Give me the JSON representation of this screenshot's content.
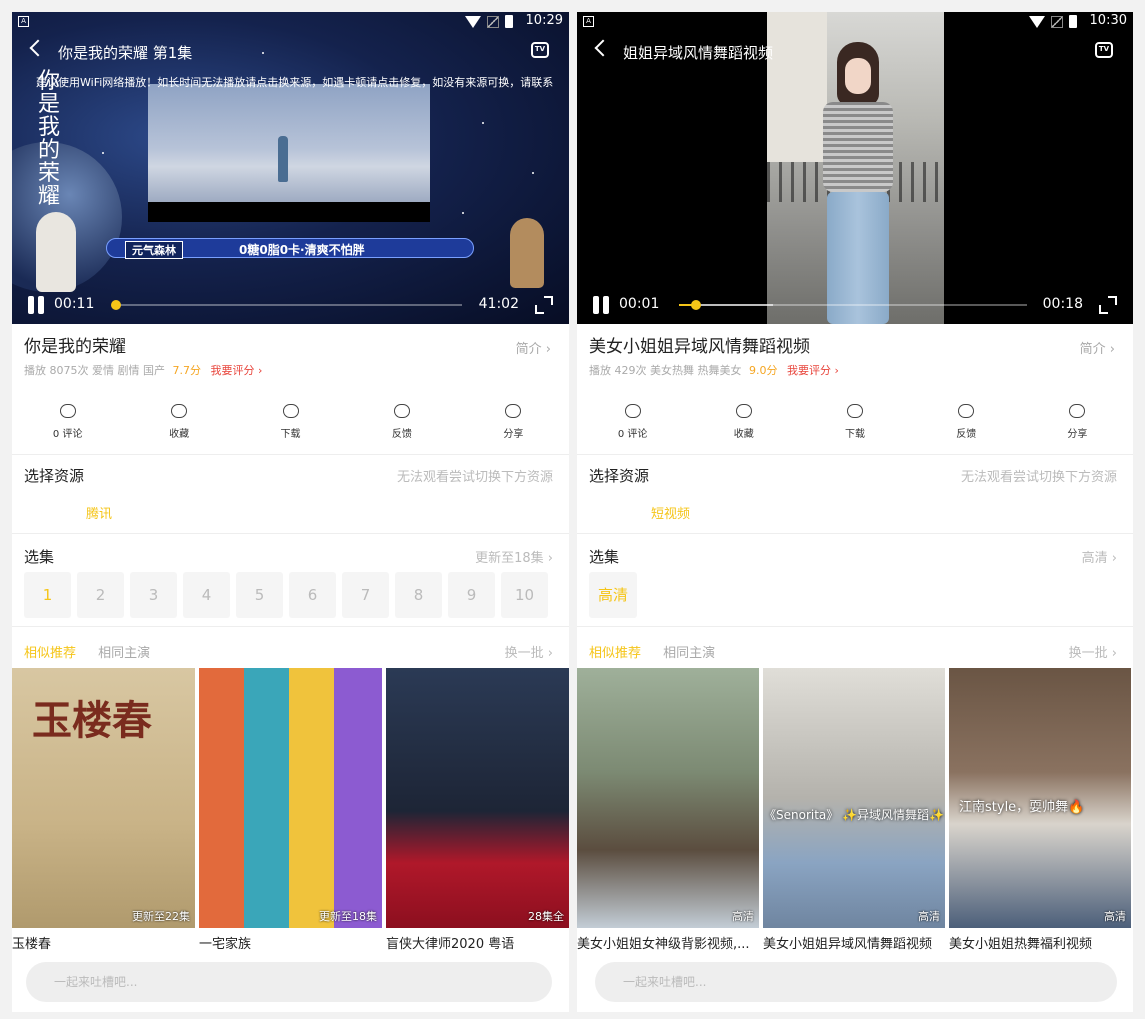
{
  "screens": [
    {
      "status": {
        "time": "10:29",
        "sim": "A"
      },
      "title": "你是我的荣耀 第1集",
      "notice": "建议使用WiFi网络播放！如长时间无法播放请点击换来源，如遇卡顿请点击修复，如没有来源可换，请联系",
      "poster_text": "你是我的荣耀",
      "ad_tag": "元气森林",
      "ad_slogan": "0糖0脂0卡·清爽不怕胖",
      "player": {
        "current": "00:11",
        "duration": "41:02",
        "progress": 0.01,
        "buffered": 0.0
      },
      "video_title": "你是我的荣耀",
      "intro": "简介 ›",
      "meta": {
        "plays": "播放 8075次",
        "tags": "爱情 剧情 国产",
        "score": "7.7分",
        "rate": "我要评分 ›"
      },
      "actions": [
        {
          "label": "0 评论",
          "icon": "comment-icon"
        },
        {
          "label": "收藏",
          "icon": "heart-icon"
        },
        {
          "label": "下载",
          "icon": "download-icon"
        },
        {
          "label": "反馈",
          "icon": "feedback-icon"
        },
        {
          "label": "分享",
          "icon": "share-icon"
        }
      ],
      "source_title": "选择资源",
      "source_hint": "无法观看尝试切换下方资源",
      "source": "腾讯",
      "episodes_title": "选集",
      "episodes_note": "更新至18集 ›",
      "episodes": [
        "1",
        "2",
        "3",
        "4",
        "5",
        "6",
        "7",
        "8",
        "9",
        "10"
      ],
      "tab_similar": "相似推荐",
      "tab_cast": "相同主演",
      "refresh": "换一批 ›",
      "recs": [
        {
          "name": "玉楼春",
          "badge": "更新至22集"
        },
        {
          "name": "一宅家族",
          "badge": "更新至18集"
        },
        {
          "name": "盲侠大律师2020 粤语",
          "badge": "28集全"
        }
      ],
      "comment_placeholder": "一起来吐槽吧..."
    },
    {
      "status": {
        "time": "10:30",
        "sim": "A"
      },
      "title": "姐姐异域风情舞蹈视频",
      "player": {
        "current": "00:01",
        "duration": "00:18",
        "progress": 0.05,
        "buffered": 0.27
      },
      "video_title": "美女小姐姐异域风情舞蹈视频",
      "intro": "简介 ›",
      "meta": {
        "plays": "播放 429次",
        "tags": "美女热舞 热舞美女",
        "score": "9.0分",
        "rate": "我要评分 ›"
      },
      "actions": [
        {
          "label": "0 评论",
          "icon": "comment-icon"
        },
        {
          "label": "收藏",
          "icon": "heart-icon"
        },
        {
          "label": "下载",
          "icon": "download-icon"
        },
        {
          "label": "反馈",
          "icon": "feedback-icon"
        },
        {
          "label": "分享",
          "icon": "share-icon"
        }
      ],
      "source_title": "选择资源",
      "source_hint": "无法观看尝试切换下方资源",
      "source": "短视频",
      "episodes_title": "选集",
      "episodes_note": "高清 ›",
      "episodes": [
        "高清"
      ],
      "tab_similar": "相似推荐",
      "tab_cast": "相同主演",
      "refresh": "换一批 ›",
      "recs": [
        {
          "name": "美女小姐姐女神级背影视频,...",
          "badge": "高清",
          "overlay": ""
        },
        {
          "name": "美女小姐姐异域风情舞蹈视频",
          "badge": "高清",
          "overlay": "《Senorita》 ✨异域风情舞蹈✨"
        },
        {
          "name": "美女小姐姐热舞福利视频",
          "badge": "高清",
          "overlay": "江南style，耍帅舞🔥"
        }
      ],
      "comment_placeholder": "一起来吐槽吧..."
    }
  ],
  "colors": {
    "accent": "#f5c518",
    "rate": "#e8453c",
    "score": "#f5a623"
  }
}
